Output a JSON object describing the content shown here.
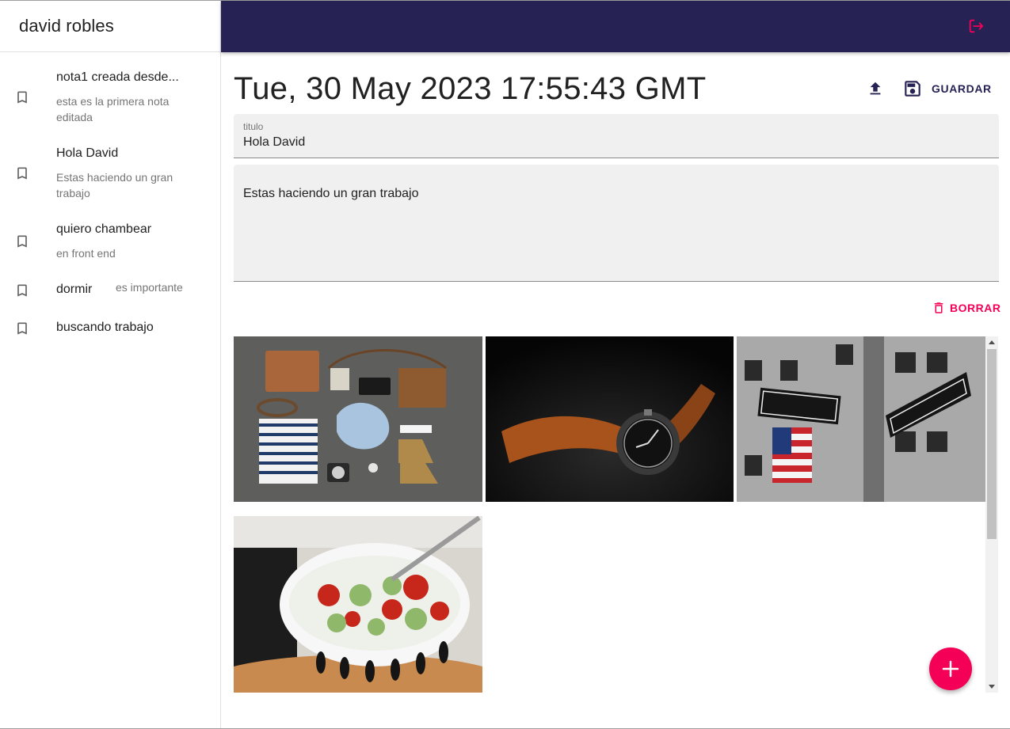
{
  "sidebar": {
    "user_name": "david robles",
    "notes": [
      {
        "title": "nota1 creada desde...",
        "body": "esta es la primera nota editada",
        "icon": "bookmark-icon"
      },
      {
        "title": "Hola David",
        "body": "Estas haciendo un gran trabajo",
        "icon": "bookmark-icon"
      },
      {
        "title": "quiero chambear",
        "body": "en front end",
        "icon": "bookmark-icon"
      },
      {
        "title": "dormir",
        "body": "es importante",
        "icon": "bookmark-icon"
      },
      {
        "title": "buscando trabajo",
        "body": "",
        "icon": "bookmark-icon"
      }
    ]
  },
  "topbar": {
    "logout_icon": "logout-icon"
  },
  "note": {
    "date": "Tue, 30 May 2023 17:55:43 GMT",
    "title_label": "titulo",
    "title_value": "Hola David",
    "body_value": "Estas haciendo un gran trabajo",
    "save_label": "GUARDAR",
    "delete_label": "BORRAR",
    "upload_icon": "upload-icon",
    "save_icon": "save-icon",
    "delete_icon": "trash-icon"
  },
  "gallery": {
    "images": [
      "flat-lay-items-photo",
      "wristwatch-photo",
      "broadway-morris-street-sign-photo",
      "salad-bowl-photo"
    ]
  },
  "fab": {
    "icon": "plus-icon"
  },
  "colors": {
    "topbar": "#262254",
    "accent": "#f50057",
    "field_bg": "#f0f0f0"
  }
}
